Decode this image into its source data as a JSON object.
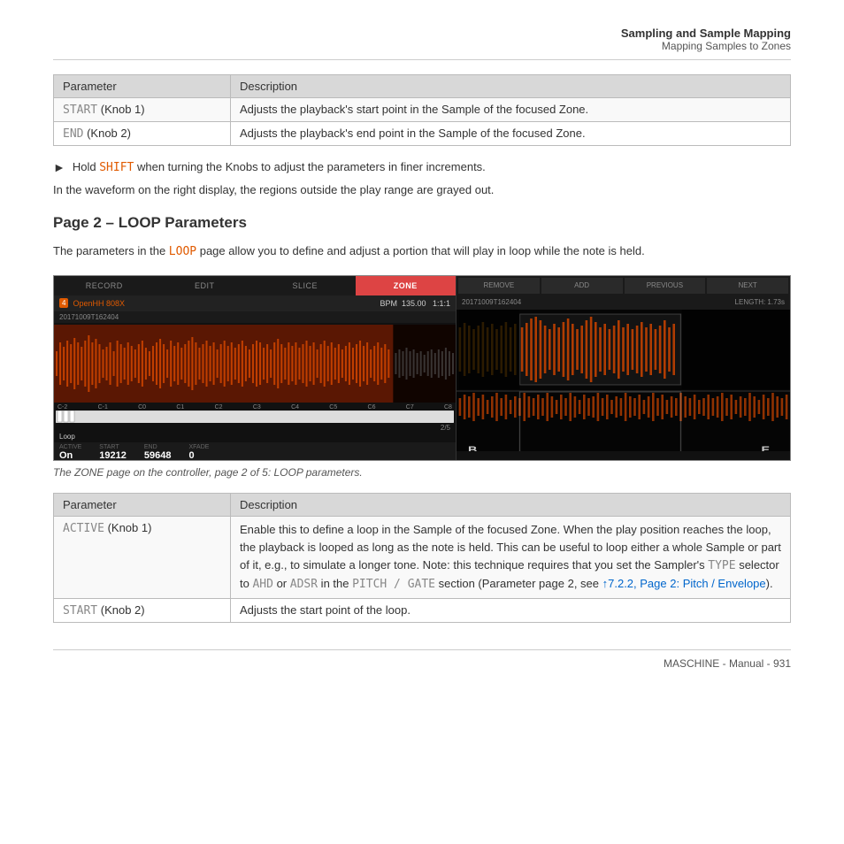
{
  "header": {
    "title": "Sampling and Sample Mapping",
    "subtitle": "Mapping Samples to Zones"
  },
  "top_table": {
    "col1": "Parameter",
    "col2": "Description",
    "rows": [
      {
        "param_mono": "START",
        "param_text": " (Knob 1)",
        "desc": "Adjusts the playback's start point in the Sample of the focused Zone."
      },
      {
        "param_mono": "END",
        "param_text": " (Knob 2)",
        "desc": "Adjusts the playback's end point in the Sample of the focused Zone."
      }
    ]
  },
  "shift_note": "Hold SHIFT when turning the Knobs to adjust the parameters in finer increments.",
  "shift_word": "SHIFT",
  "waveform_note": "In the waveform on the right display, the regions outside the play range are grayed out.",
  "section_heading": "Page 2 – LOOP Parameters",
  "loop_intro": "The parameters in the LOOP page allow you to define and adjust a portion that will play in loop while the note is held.",
  "loop_word": "LOOP",
  "controller": {
    "left": {
      "tabs": [
        "RECORD",
        "EDIT",
        "SLICE",
        "ZONE"
      ],
      "active_tab": "ZONE",
      "badge": "4",
      "sample_name": "OpenHH 808X",
      "bpm": "BPM  135.00   1:1:1",
      "filename": "20171009T162404",
      "keyboard_labels": [
        "C-2",
        "C-1",
        "C0",
        "C1",
        "C2",
        "C3",
        "C4",
        "C5",
        "C6",
        "C7",
        "C8"
      ],
      "page_indicator": "2/5",
      "loop_label": "Loop",
      "params": [
        {
          "label": "ACTIVE",
          "value": "On"
        },
        {
          "label": "START",
          "value": "19212"
        },
        {
          "label": "END",
          "value": "59648"
        },
        {
          "label": "XFADE",
          "value": "0"
        }
      ]
    },
    "right": {
      "tabs": [
        "REMOVE",
        "ADD",
        "PREVIOUS",
        "NEXT"
      ],
      "filename": "20171009T162404",
      "length": "LENGTH: 1.73s",
      "marker_b": "B",
      "marker_e": "E"
    }
  },
  "image_caption": "The ZONE page on the controller, page 2 of 5: LOOP parameters.",
  "bottom_table": {
    "col1": "Parameter",
    "col2": "Description",
    "rows": [
      {
        "param_mono": "ACTIVE",
        "param_text": " (Knob 1)",
        "desc_paragraphs": [
          "Enable this to define a loop in the Sample of the focused Zone. When the play position reaches the loop, the playback is looped as long as the note is held. This can be useful to loop either a whole Sample or part of it, e.g., to simulate a longer tone. Note: this technique requires that you set the Sampler's TYPE selector to AHD or ADSR in the PITCH / GATE section (Parameter page 2, see ↑7.2.2, Page 2: Pitch / Envelope).",
          ""
        ],
        "has_link": true,
        "link_text": "↑7.2.2, Page 2: Pitch / Envelope",
        "inline_monos": [
          "TYPE",
          "AHD",
          "ADSR",
          "PITCH / GATE"
        ]
      },
      {
        "param_mono": "START",
        "param_text": " (Knob 2)",
        "desc_paragraphs": [
          "Adjusts the start point of the loop."
        ],
        "has_link": false
      }
    ]
  },
  "footer": "MASCHINE - Manual - 931"
}
